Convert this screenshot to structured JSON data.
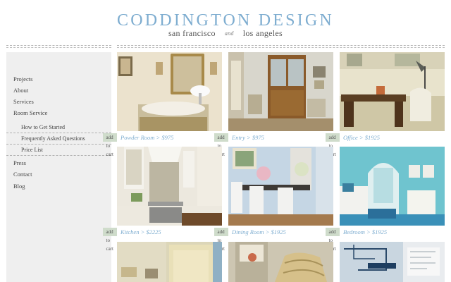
{
  "header": {
    "brand": "CODDINGTON DESIGN",
    "city1": "san francisco",
    "and": "and",
    "city2": "los angeles"
  },
  "sidebar": {
    "items": [
      {
        "label": "Projects"
      },
      {
        "label": "About"
      },
      {
        "label": "Services"
      },
      {
        "label": "Room Service"
      }
    ],
    "subitems": [
      {
        "label": "How to Get Started"
      },
      {
        "label": "Frequently Asked Questions"
      },
      {
        "label": "Price List"
      }
    ],
    "items_after": [
      {
        "label": "Press"
      },
      {
        "label": "Contact"
      },
      {
        "label": "Blog"
      }
    ]
  },
  "colors": {
    "brand_blue": "#7eadd0",
    "cart_bg": "#cfdccb",
    "sidebar_bg": "#efefef"
  },
  "gallery": [
    {
      "caption": "Powder Room > $975",
      "cart": "add to cart",
      "image": "powder-room-photo"
    },
    {
      "caption": "Entry > $975",
      "cart": "add to cart",
      "image": "entry-photo"
    },
    {
      "caption": "Office > $1925",
      "cart": "add to cart",
      "image": "office-photo"
    },
    {
      "caption": "Kitchen > $2225",
      "cart": "add to cart",
      "image": "kitchen-photo"
    },
    {
      "caption": "Dining Room > $1925",
      "cart": "add to cart",
      "image": "dining-room-photo"
    },
    {
      "caption": "Bedroom > $1925",
      "cart": "add to cart",
      "image": "bedroom-photo"
    },
    {
      "image": "living-room-photo"
    },
    {
      "image": "shelf-vignette-photo"
    },
    {
      "image": "floor-plan-photo"
    }
  ]
}
